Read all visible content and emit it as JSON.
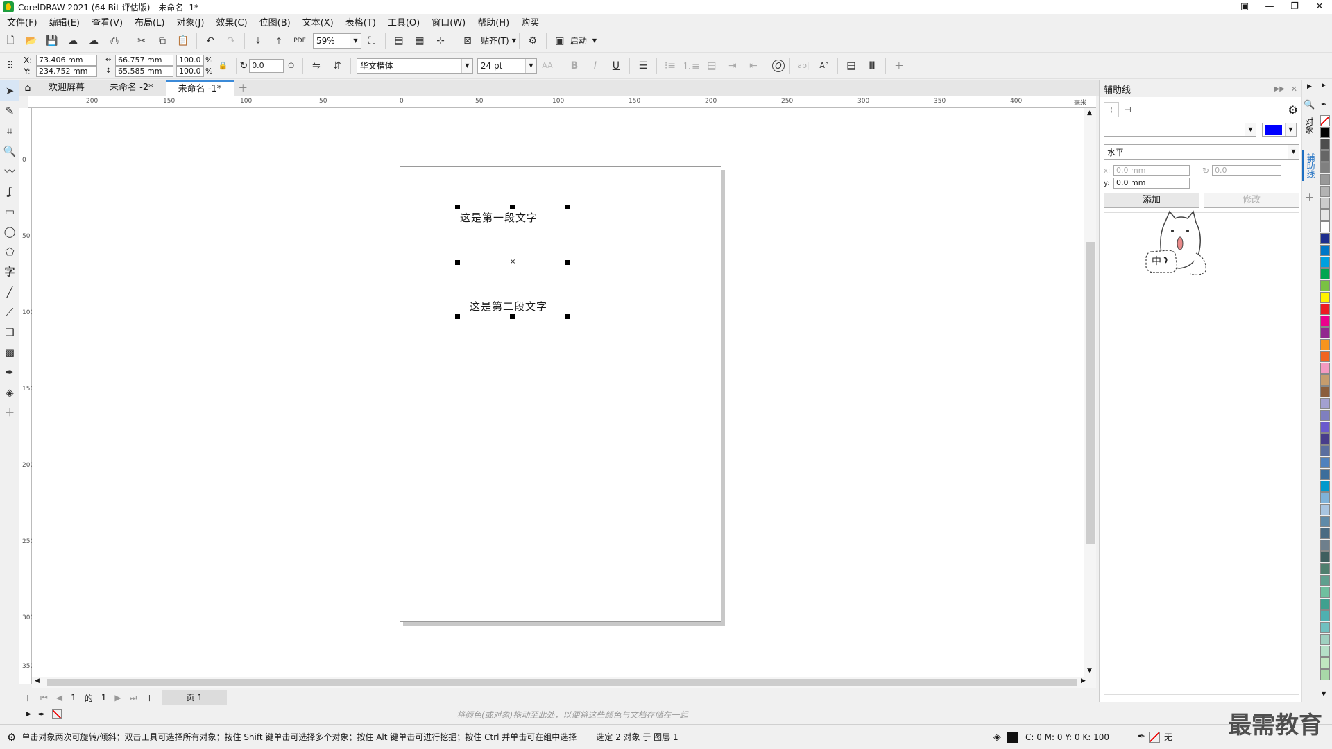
{
  "window": {
    "title": "CorelDRAW 2021 (64-Bit 评估版) - 未命名 -1*"
  },
  "menu": [
    "文件(F)",
    "编辑(E)",
    "查看(V)",
    "布局(L)",
    "对象(J)",
    "效果(C)",
    "位图(B)",
    "文本(X)",
    "表格(T)",
    "工具(O)",
    "窗口(W)",
    "帮助(H)",
    "购买"
  ],
  "toolbar": {
    "zoom": "59%",
    "snap_label": "贴齐(T)",
    "launch_label": "启动"
  },
  "property_bar": {
    "x_label": "X:",
    "x": "73.406 mm",
    "y_label": "Y:",
    "y": "234.752 mm",
    "width": "66.757 mm",
    "height": "65.585 mm",
    "scale_w": "100.0",
    "scale_h": "100.0",
    "pct": "%",
    "angle": "0.0",
    "font_name": "华文楷体",
    "font_size": "24 pt"
  },
  "tabs": [
    "欢迎屏幕",
    "未命名 -2*",
    "未命名 -1*"
  ],
  "ruler": {
    "h_labels": [
      "200",
      "150",
      "100",
      "50",
      "0",
      "50",
      "100",
      "150",
      "200",
      "250",
      "300",
      "350",
      "400"
    ],
    "v_labels": [
      "0",
      "50",
      "100",
      "150",
      "200",
      "250",
      "300",
      "350"
    ],
    "unit": "毫米"
  },
  "page": {
    "text1": "这是第一段文字",
    "text2": "这是第二段文字"
  },
  "page_nav": {
    "current": "1",
    "of": "的",
    "total": "1",
    "page_tab": "页 1"
  },
  "color_hint": "将颜色(或对象)拖动至此处，以便将这些颜色与文档存储在一起",
  "status": {
    "message": "单击对象两次可旋转/倾斜；双击工具可选择所有对象；按住 Shift 键单击可选择多个对象；按住 Alt 键单击可进行挖掘；按住 Ctrl 并单击可在组中选择",
    "selection": "选定 2 对象 于 图层 1",
    "fill": "C: 0 M: 0 Y: 0 K: 100",
    "outline": "无"
  },
  "docker": {
    "title": "辅助线",
    "orientation": "水平",
    "x_value": "0.0 mm",
    "y_value": "0.0 mm",
    "angle_value": "0.0",
    "add_label": "添加",
    "modify_label": "修改",
    "x_label": "x:",
    "y_label": "y:",
    "line_color": "#0000ff"
  },
  "side_tabs": [
    "对象",
    "辅助线"
  ],
  "watermark": "最需教育",
  "palette": [
    "#ffffff",
    "#000000",
    "#4d4d4d",
    "#666666",
    "#808080",
    "#999999",
    "#b3b3b3",
    "#cccccc",
    "#e6e6e6",
    "#ffffff",
    "#1f2f8f",
    "#0077c8",
    "#00a0e0",
    "#00a651",
    "#7ac143",
    "#fff200",
    "#ed1c24",
    "#ec008c",
    "#92278f",
    "#f7941d",
    "#f26522",
    "#f49ac1",
    "#c69c6d",
    "#8b5e3c",
    "#a3a0d0",
    "#7f7fbf",
    "#6a5acd",
    "#483d8b",
    "#5a6e9f",
    "#4f81bd",
    "#3c6e9b",
    "#0099cc",
    "#7fb2d9",
    "#a8c4e0",
    "#5f8aa8",
    "#4a6b82",
    "#6e7f8c",
    "#3f5f5f",
    "#4f7f6f",
    "#5fa08f",
    "#6fbf9f",
    "#3fa08f",
    "#4fb0b0",
    "#70c0c0",
    "#9fd0c0",
    "#b5dfc7",
    "#c0e6c0",
    "#a8d8a8"
  ]
}
